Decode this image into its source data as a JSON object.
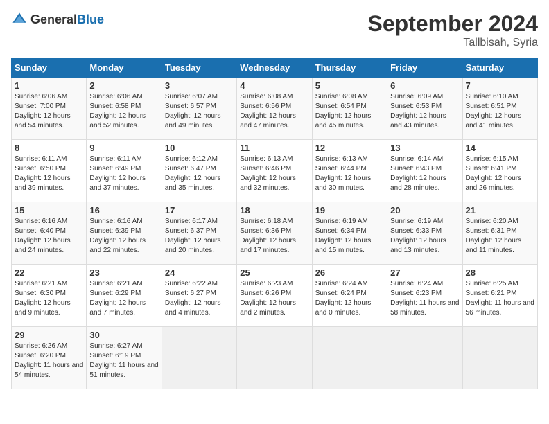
{
  "header": {
    "logo_general": "General",
    "logo_blue": "Blue",
    "month": "September 2024",
    "location": "Tallbisah, Syria"
  },
  "days_of_week": [
    "Sunday",
    "Monday",
    "Tuesday",
    "Wednesday",
    "Thursday",
    "Friday",
    "Saturday"
  ],
  "weeks": [
    [
      {
        "day": "1",
        "sunrise": "6:06 AM",
        "sunset": "7:00 PM",
        "daylight": "12 hours and 54 minutes."
      },
      {
        "day": "2",
        "sunrise": "6:06 AM",
        "sunset": "6:58 PM",
        "daylight": "12 hours and 52 minutes."
      },
      {
        "day": "3",
        "sunrise": "6:07 AM",
        "sunset": "6:57 PM",
        "daylight": "12 hours and 49 minutes."
      },
      {
        "day": "4",
        "sunrise": "6:08 AM",
        "sunset": "6:56 PM",
        "daylight": "12 hours and 47 minutes."
      },
      {
        "day": "5",
        "sunrise": "6:08 AM",
        "sunset": "6:54 PM",
        "daylight": "12 hours and 45 minutes."
      },
      {
        "day": "6",
        "sunrise": "6:09 AM",
        "sunset": "6:53 PM",
        "daylight": "12 hours and 43 minutes."
      },
      {
        "day": "7",
        "sunrise": "6:10 AM",
        "sunset": "6:51 PM",
        "daylight": "12 hours and 41 minutes."
      }
    ],
    [
      {
        "day": "8",
        "sunrise": "6:11 AM",
        "sunset": "6:50 PM",
        "daylight": "12 hours and 39 minutes."
      },
      {
        "day": "9",
        "sunrise": "6:11 AM",
        "sunset": "6:49 PM",
        "daylight": "12 hours and 37 minutes."
      },
      {
        "day": "10",
        "sunrise": "6:12 AM",
        "sunset": "6:47 PM",
        "daylight": "12 hours and 35 minutes."
      },
      {
        "day": "11",
        "sunrise": "6:13 AM",
        "sunset": "6:46 PM",
        "daylight": "12 hours and 32 minutes."
      },
      {
        "day": "12",
        "sunrise": "6:13 AM",
        "sunset": "6:44 PM",
        "daylight": "12 hours and 30 minutes."
      },
      {
        "day": "13",
        "sunrise": "6:14 AM",
        "sunset": "6:43 PM",
        "daylight": "12 hours and 28 minutes."
      },
      {
        "day": "14",
        "sunrise": "6:15 AM",
        "sunset": "6:41 PM",
        "daylight": "12 hours and 26 minutes."
      }
    ],
    [
      {
        "day": "15",
        "sunrise": "6:16 AM",
        "sunset": "6:40 PM",
        "daylight": "12 hours and 24 minutes."
      },
      {
        "day": "16",
        "sunrise": "6:16 AM",
        "sunset": "6:39 PM",
        "daylight": "12 hours and 22 minutes."
      },
      {
        "day": "17",
        "sunrise": "6:17 AM",
        "sunset": "6:37 PM",
        "daylight": "12 hours and 20 minutes."
      },
      {
        "day": "18",
        "sunrise": "6:18 AM",
        "sunset": "6:36 PM",
        "daylight": "12 hours and 17 minutes."
      },
      {
        "day": "19",
        "sunrise": "6:19 AM",
        "sunset": "6:34 PM",
        "daylight": "12 hours and 15 minutes."
      },
      {
        "day": "20",
        "sunrise": "6:19 AM",
        "sunset": "6:33 PM",
        "daylight": "12 hours and 13 minutes."
      },
      {
        "day": "21",
        "sunrise": "6:20 AM",
        "sunset": "6:31 PM",
        "daylight": "12 hours and 11 minutes."
      }
    ],
    [
      {
        "day": "22",
        "sunrise": "6:21 AM",
        "sunset": "6:30 PM",
        "daylight": "12 hours and 9 minutes."
      },
      {
        "day": "23",
        "sunrise": "6:21 AM",
        "sunset": "6:29 PM",
        "daylight": "12 hours and 7 minutes."
      },
      {
        "day": "24",
        "sunrise": "6:22 AM",
        "sunset": "6:27 PM",
        "daylight": "12 hours and 4 minutes."
      },
      {
        "day": "25",
        "sunrise": "6:23 AM",
        "sunset": "6:26 PM",
        "daylight": "12 hours and 2 minutes."
      },
      {
        "day": "26",
        "sunrise": "6:24 AM",
        "sunset": "6:24 PM",
        "daylight": "12 hours and 0 minutes."
      },
      {
        "day": "27",
        "sunrise": "6:24 AM",
        "sunset": "6:23 PM",
        "daylight": "11 hours and 58 minutes."
      },
      {
        "day": "28",
        "sunrise": "6:25 AM",
        "sunset": "6:21 PM",
        "daylight": "11 hours and 56 minutes."
      }
    ],
    [
      {
        "day": "29",
        "sunrise": "6:26 AM",
        "sunset": "6:20 PM",
        "daylight": "11 hours and 54 minutes."
      },
      {
        "day": "30",
        "sunrise": "6:27 AM",
        "sunset": "6:19 PM",
        "daylight": "11 hours and 51 minutes."
      },
      null,
      null,
      null,
      null,
      null
    ]
  ]
}
